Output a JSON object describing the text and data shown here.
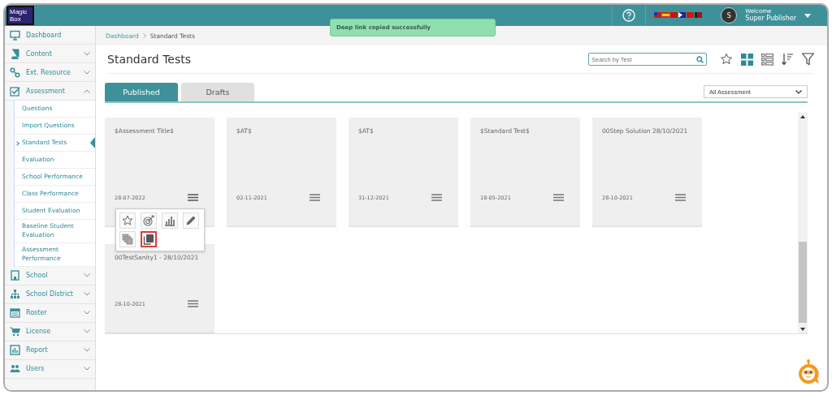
{
  "header": {
    "logo": "MagicBox",
    "welcome": "Welcome",
    "user": "Super Publisher",
    "avatar": "S"
  },
  "toast": "Deep link copied successfully",
  "sidebar": {
    "items": [
      {
        "label": "Dashboard",
        "kind": "monitor"
      },
      {
        "label": "Content",
        "kind": "book",
        "expanded": false
      },
      {
        "label": "Ext. Resource",
        "kind": "link",
        "expanded": false
      },
      {
        "label": "Assessment",
        "kind": "check",
        "expanded": true,
        "children": [
          {
            "label": "Questions",
            "selected": false
          },
          {
            "label": "Import Questions",
            "selected": false
          },
          {
            "label": "Standard Tests",
            "selected": true
          },
          {
            "label": "Evaluation",
            "selected": false
          },
          {
            "label": "School Performance",
            "selected": false
          },
          {
            "label": "Class Performance",
            "selected": false
          },
          {
            "label": "Student Evaluation",
            "selected": false
          },
          {
            "label": "Baseline Student Evaluation",
            "selected": false
          },
          {
            "label": "Assessment Performance",
            "selected": false
          }
        ]
      },
      {
        "label": "School",
        "kind": "building",
        "expanded": false
      },
      {
        "label": "School District",
        "kind": "tree",
        "expanded": false
      },
      {
        "label": "Roster",
        "kind": "calendar",
        "expanded": false
      },
      {
        "label": "License",
        "kind": "cart",
        "expanded": false
      },
      {
        "label": "Report",
        "kind": "chart",
        "expanded": false
      },
      {
        "label": "Users",
        "kind": "users",
        "expanded": false
      }
    ]
  },
  "breadcrumb": [
    "Dashboard",
    "Standard Tests"
  ],
  "page_title": "Standard Tests",
  "search": {
    "placeholder": "Search by Test"
  },
  "view_buttons": [
    {
      "kind": "grid",
      "selected": true
    },
    {
      "kind": "list",
      "selected": false
    }
  ],
  "tabs": [
    {
      "label": "Published",
      "selected": true
    },
    {
      "label": "Drafts",
      "selected": false
    }
  ],
  "filter": {
    "value": "All Assessment"
  },
  "cards": [
    {
      "title": "$Assessment Title$",
      "date": "28-07-2022",
      "menu_open": true
    },
    {
      "title": "$AT$",
      "date": "02-11-2021",
      "menu_open": false
    },
    {
      "title": "$AT$",
      "date": "31-12-2021",
      "menu_open": false
    },
    {
      "title": "$Standard Test$",
      "date": "18-05-2021",
      "menu_open": false
    },
    {
      "title": "00Step Solution 28/10/2021",
      "date": "28-10-2021",
      "menu_open": false
    },
    {
      "title": "00TestSanity1 - 28/10/2021",
      "date": "28-10-2021",
      "menu_open": false
    }
  ],
  "card_menu": [
    {
      "kind": "star",
      "selected": false
    },
    {
      "kind": "target",
      "selected": false
    },
    {
      "kind": "bars",
      "selected": false
    },
    {
      "kind": "pencil",
      "selected": false
    },
    {
      "kind": "copy-stack",
      "selected": false
    },
    {
      "kind": "copy",
      "selected": true
    }
  ]
}
